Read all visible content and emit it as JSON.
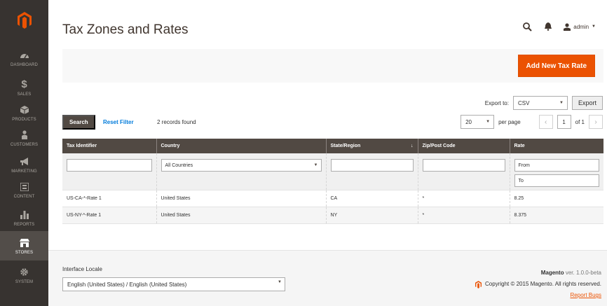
{
  "sidebar": {
    "items": [
      {
        "label": "DASHBOARD",
        "icon": "dashboard-icon"
      },
      {
        "label": "SALES",
        "icon": "dollar-icon"
      },
      {
        "label": "PRODUCTS",
        "icon": "cube-icon"
      },
      {
        "label": "CUSTOMERS",
        "icon": "person-icon"
      },
      {
        "label": "MARKETING",
        "icon": "megaphone-icon"
      },
      {
        "label": "CONTENT",
        "icon": "content-icon"
      },
      {
        "label": "REPORTS",
        "icon": "bar-chart-icon"
      },
      {
        "label": "STORES",
        "icon": "store-icon",
        "active": true
      },
      {
        "label": "SYSTEM",
        "icon": "gear-icon"
      }
    ]
  },
  "header": {
    "title": "Tax Zones and Rates",
    "user": "admin"
  },
  "actions": {
    "add_label": "Add New Tax Rate"
  },
  "export": {
    "label": "Export to:",
    "format": "CSV",
    "button": "Export"
  },
  "toolbar": {
    "search_label": "Search",
    "reset_label": "Reset Filter",
    "records": "2 records found",
    "per_page": "20",
    "per_page_label": "per page",
    "page": "1",
    "of_pages": "of 1"
  },
  "grid": {
    "columns": [
      "Tax Identifier",
      "Country",
      "State/Region",
      "Zip/Post Code",
      "Rate"
    ],
    "filters": {
      "country": "All Countries",
      "rate_from": "From",
      "rate_to": "To"
    },
    "rows": [
      {
        "id": "US-CA-*-Rate 1",
        "country": "United States",
        "region": "CA",
        "zip": "*",
        "rate": "8.25"
      },
      {
        "id": "US-NY-*-Rate 1",
        "country": "United States",
        "region": "NY",
        "zip": "*",
        "rate": "8.375"
      }
    ]
  },
  "footer": {
    "locale_label": "Interface Locale",
    "locale_value": "English (United States) / English (United States)",
    "brand": "Magento",
    "version": "ver. 1.0.0-beta",
    "copyright": "Copyright © 2015 Magento. All rights reserved.",
    "report": "Report Bugs"
  },
  "colors": {
    "sidebar": "#373330",
    "accent": "#eb5202",
    "header_row": "#514943",
    "link": "#007bdb"
  }
}
